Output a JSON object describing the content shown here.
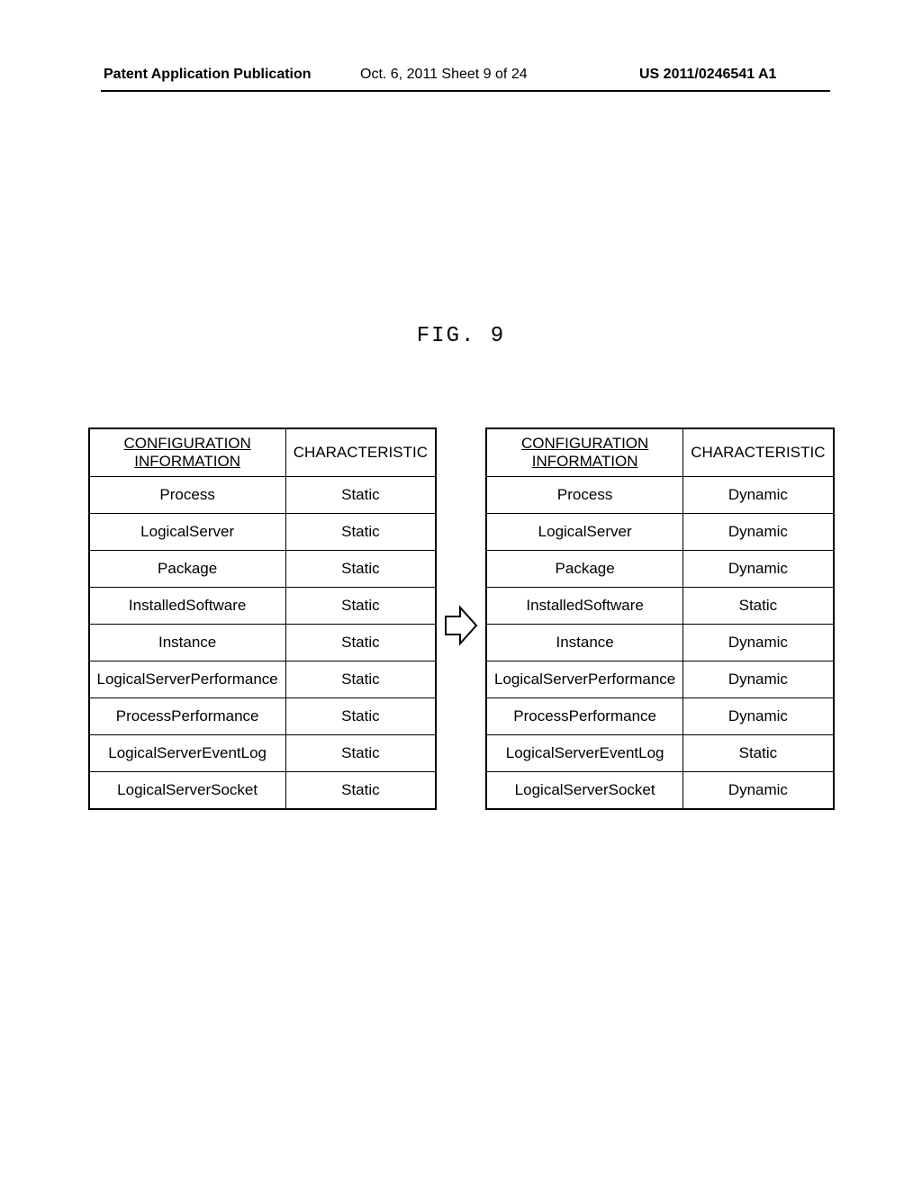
{
  "header": {
    "left": "Patent Application Publication",
    "center": "Oct. 6, 2011  Sheet 9 of 24",
    "right": "US 2011/0246541 A1"
  },
  "figure_title": "FIG. 9",
  "left_table": {
    "headers": {
      "config": "CONFIGURATION INFORMATION",
      "char": "CHARACTERISTIC"
    },
    "rows": [
      {
        "config": "Process",
        "char": "Static"
      },
      {
        "config": "LogicalServer",
        "char": "Static"
      },
      {
        "config": "Package",
        "char": "Static"
      },
      {
        "config": "InstalledSoftware",
        "char": "Static"
      },
      {
        "config": "Instance",
        "char": "Static"
      },
      {
        "config": "LogicalServerPerformance",
        "char": "Static"
      },
      {
        "config": "ProcessPerformance",
        "char": "Static"
      },
      {
        "config": "LogicalServerEventLog",
        "char": "Static"
      },
      {
        "config": "LogicalServerSocket",
        "char": "Static"
      }
    ]
  },
  "right_table": {
    "headers": {
      "config": "CONFIGURATION INFORMATION",
      "char": "CHARACTERISTIC"
    },
    "rows": [
      {
        "config": "Process",
        "char": "Dynamic"
      },
      {
        "config": "LogicalServer",
        "char": "Dynamic"
      },
      {
        "config": "Package",
        "char": "Dynamic"
      },
      {
        "config": "InstalledSoftware",
        "char": "Static"
      },
      {
        "config": "Instance",
        "char": "Dynamic"
      },
      {
        "config": "LogicalServerPerformance",
        "char": "Dynamic"
      },
      {
        "config": "ProcessPerformance",
        "char": "Dynamic"
      },
      {
        "config": "LogicalServerEventLog",
        "char": "Static"
      },
      {
        "config": "LogicalServerSocket",
        "char": "Dynamic"
      }
    ]
  }
}
